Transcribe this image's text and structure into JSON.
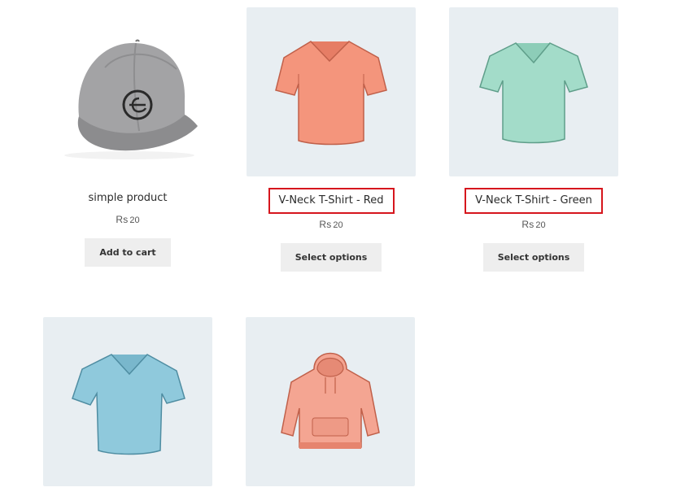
{
  "products": [
    {
      "title": "simple product",
      "currency": "Rs",
      "price": "20",
      "button": "Add to cart",
      "image_icon": "cap-icon"
    },
    {
      "title": "V-Neck T-Shirt - Red",
      "currency": "Rs",
      "price": "20",
      "button": "Select options",
      "image_icon": "tshirt-red-icon",
      "shirt_color": "#f4957c"
    },
    {
      "title": "V-Neck T-Shirt - Green",
      "currency": "Rs",
      "price": "20",
      "button": "Select options",
      "image_icon": "tshirt-green-icon",
      "shirt_color": "#a3dcc9"
    },
    {
      "image_icon": "tshirt-blue-icon",
      "shirt_color": "#8fc9dc"
    },
    {
      "image_icon": "hoodie-icon",
      "shirt_color": "#f4a592"
    }
  ],
  "colors": {
    "image_bg": "#e8eef2",
    "button_bg": "#eeeeee",
    "highlight_border": "#d6161d"
  }
}
